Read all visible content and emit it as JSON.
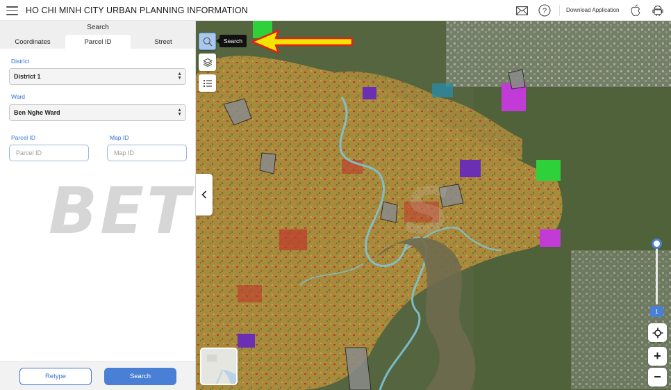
{
  "header": {
    "title": "HO CHI MINH CITY URBAN PLANNING INFORMATION",
    "menu_icon": "hamburger-icon",
    "mail_icon": "mail-icon",
    "help_icon": "help-icon",
    "download_label": "Download Application",
    "apple_icon": "apple-icon",
    "android_icon": "android-icon"
  },
  "panel": {
    "title": "Search",
    "tabs": [
      "Coordinates",
      "Parcel ID",
      "Street"
    ],
    "active_tab": "Parcel ID",
    "district": {
      "label": "District",
      "value": "District 1"
    },
    "ward": {
      "label": "Ward",
      "value": "Ben Nghe Ward"
    },
    "parcel_id": {
      "label": "Parcel ID",
      "placeholder": "Parcel ID"
    },
    "map_id": {
      "label": "Map ID",
      "placeholder": "Map ID"
    },
    "watermark": "BET",
    "retype_label": "Retype",
    "search_label": "Search"
  },
  "map": {
    "tooltip": "Search",
    "tools": [
      "search-icon",
      "layers-icon",
      "legend-list-icon"
    ],
    "zoom_level_badge": "1",
    "accent_color": "#4a7fd6",
    "annotation_arrow_color": "#f5e400",
    "annotation_arrow_outline": "#e0201b"
  }
}
